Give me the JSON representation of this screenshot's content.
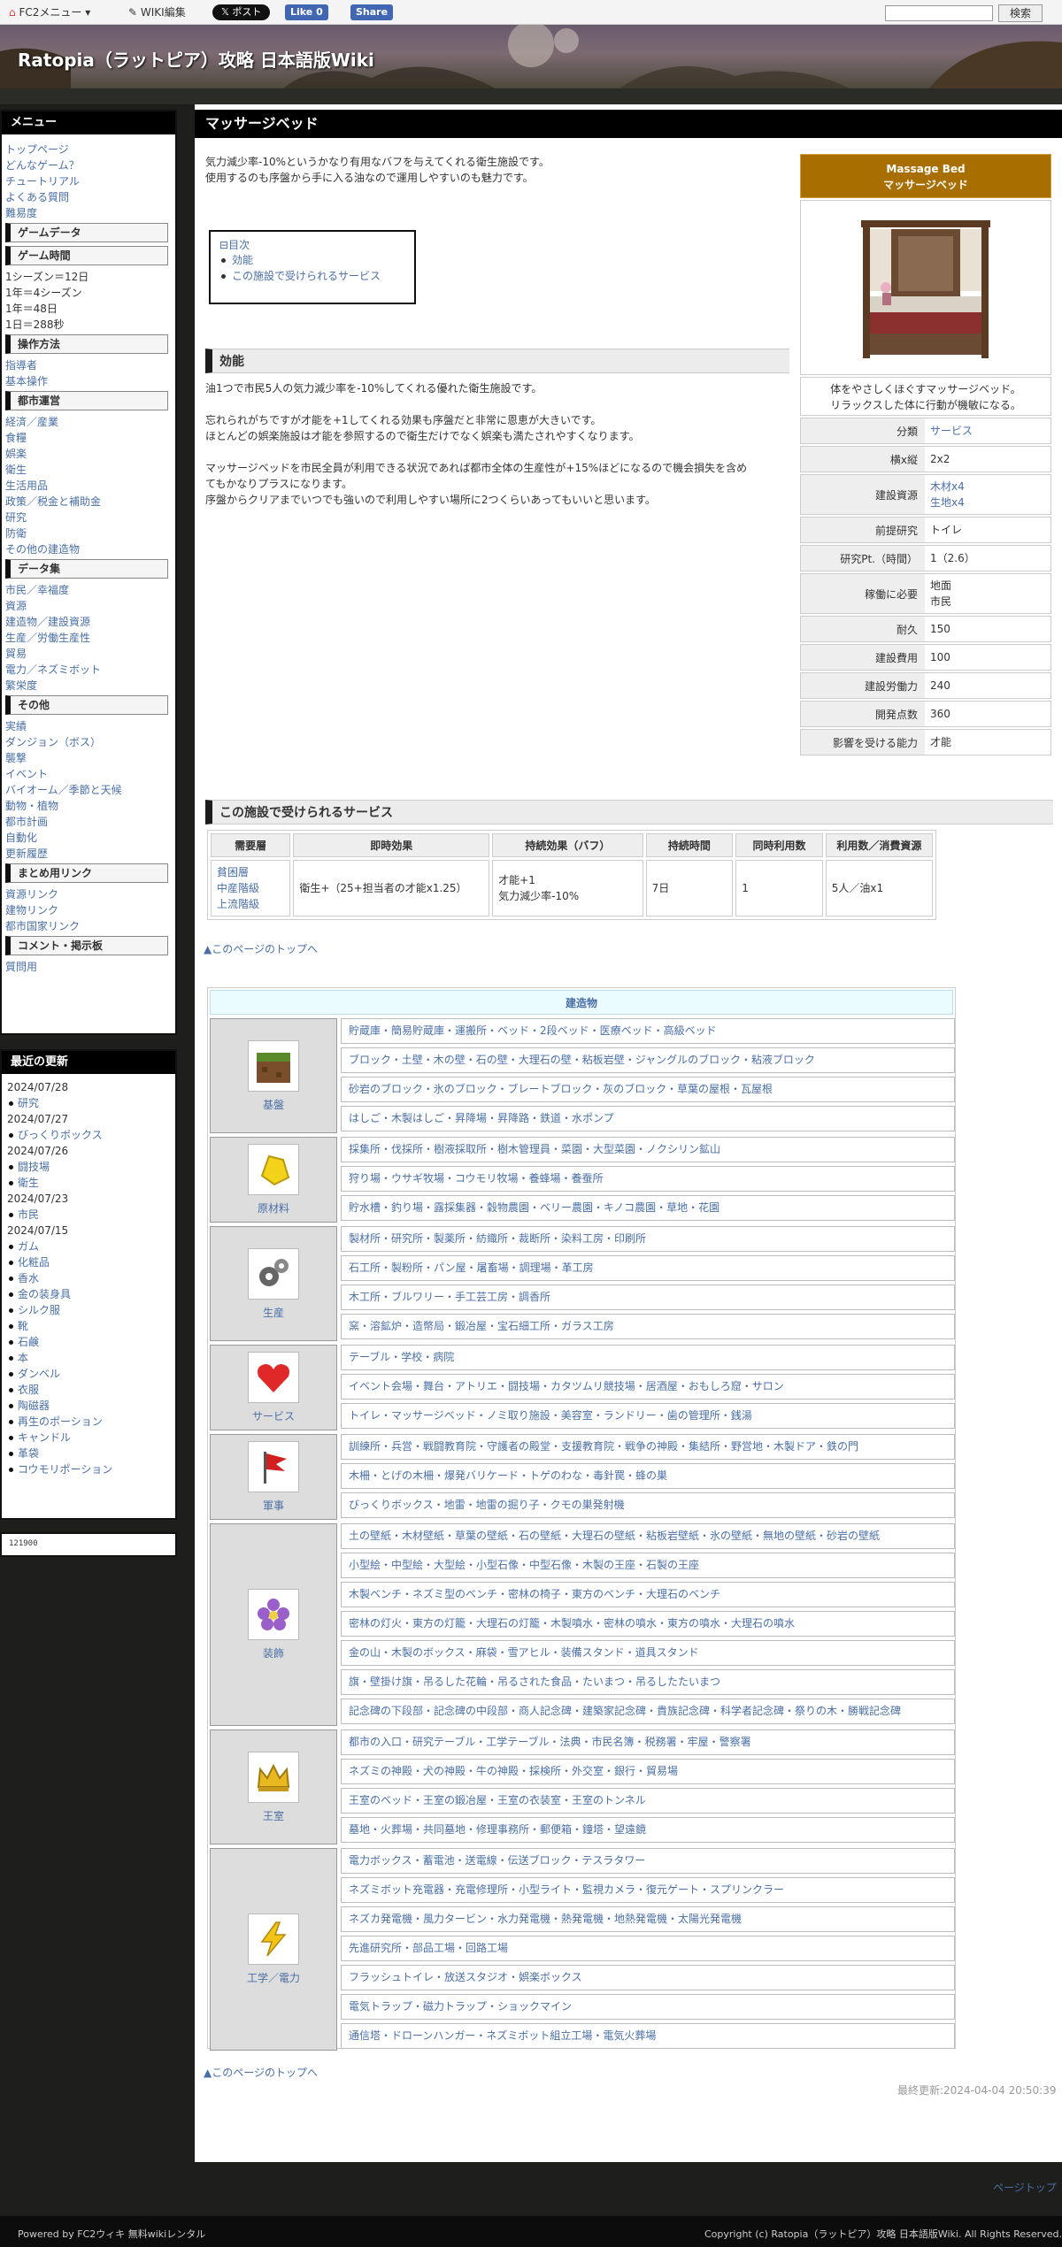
{
  "topbar": {
    "fc2_menu": "FC2メニュー",
    "wiki_edit": "WIKI編集",
    "post": "ポスト",
    "like": "Like 0",
    "share": "Share",
    "search_button": "検索"
  },
  "site_title": "Ratopia（ラットピア）攻略 日本語版Wiki",
  "sidebar": {
    "title": "メニュー",
    "links_top": [
      "トップページ",
      "どんなゲーム？",
      "チュートリアル",
      "よくある質問",
      "難易度"
    ],
    "game_data": "ゲームデータ",
    "game_time": "ゲーム時間",
    "time_lines": [
      "1シーズン＝12日",
      "1年＝4シーズン",
      "1年＝48日",
      "1日＝288秒"
    ],
    "controls": "操作方法",
    "controls_links": [
      "指導者",
      "基本操作"
    ],
    "city": "都市運営",
    "city_links": [
      "経済／産業",
      "食糧",
      "娯楽",
      "衛生",
      "生活用品",
      "政策／税金と補助金",
      "研究",
      "防衛",
      "その他の建造物"
    ],
    "data": "データ集",
    "data_links": [
      "市民／幸福度",
      "資源",
      "建造物／建設資源",
      "生産／労働生産性",
      "貿易",
      "電力／ネズミボット",
      "繁栄度"
    ],
    "other": "その他",
    "other_links": [
      "実績",
      "ダンジョン（ボス）",
      "襲撃",
      "イベント",
      "バイオーム／季節と天候",
      "動物・植物",
      "都市計画",
      "自動化",
      "更新履歴"
    ],
    "links_head": "まとめ用リンク",
    "links_links": [
      "資源リンク",
      "建物リンク",
      "都市国家リンク"
    ],
    "comment": "コメント・掲示板",
    "comment_links": [
      "質問用"
    ]
  },
  "recent": {
    "title": "最近の更新",
    "groups": [
      {
        "date": "2024/07/28",
        "items": [
          "研究"
        ]
      },
      {
        "date": "2024/07/27",
        "items": [
          "びっくりボックス"
        ]
      },
      {
        "date": "2024/07/26",
        "items": [
          "闘技場",
          "衛生"
        ]
      },
      {
        "date": "2024/07/23",
        "items": [
          "市民"
        ]
      },
      {
        "date": "2024/07/15",
        "items": [
          "ガム",
          "化粧品",
          "香水",
          "金の装身具",
          "シルク服",
          "靴",
          "石鹸",
          "本",
          "ダンベル",
          "衣服",
          "陶磁器",
          "再生のポーション",
          "キャンドル",
          "革袋",
          "コウモリポーション"
        ]
      }
    ]
  },
  "counter": "121900",
  "page": {
    "h1": "マッサージベッド",
    "intro1": "気力減少率-10%というかなり有用なバフを与えてくれる衛生施設です。",
    "intro2": "使用するのも序盤から手に入る油なので運用しやすいのも魅力です。",
    "toc_title": "目次",
    "toc_items": [
      "効能",
      "この施設で受けられるサービス"
    ],
    "h2_effect": "効能",
    "eff1": "油1つで市民5人の気力減少率を-10%してくれる優れた衛生施設です。",
    "eff2": "忘れられがちですが才能を+1してくれる効果も序盤だと非常に恩恵が大きいです。",
    "eff3": "ほとんどの娯楽施設は才能を参照するので衛生だけでなく娯楽も満たされやすくなります。",
    "eff4": "マッサージベッドを市民全員が利用できる状況であれば都市全体の生産性が+15%ほどになるので機会損失を含め",
    "eff5": "てもかなりプラスになります。",
    "eff6": "序盤からクリアまでいつでも強いので利用しやすい場所に2つくらいあってもいいと思います。",
    "h2_service": "この施設で受けられるサービス",
    "totop": "▲このページのトップへ",
    "last_update": "最終更新:2024-04-04 20:50:39",
    "ptop": "ページトップ"
  },
  "infobox": {
    "title_en": "Massage Bed",
    "title_ja": "マッサージベッド",
    "desc1": "体をやさしくほぐすマッサージベッド。",
    "desc2": "リラックスした体に行動が機敏になる。",
    "rows": [
      {
        "k": "分類",
        "v": [
          "サービス"
        ]
      },
      {
        "k": "横x縦",
        "v": [
          "2x2"
        ]
      },
      {
        "k": "建設資源",
        "v": [
          "木材x4",
          "生地x4"
        ]
      },
      {
        "k": "前提研究",
        "v": [
          "トイレ"
        ]
      },
      {
        "k": "研究Pt.（時間）",
        "v": [
          "1（2.6）"
        ]
      },
      {
        "k": "稼働に必要",
        "v": [
          "地面",
          "市民"
        ]
      },
      {
        "k": "耐久",
        "v": [
          "150"
        ]
      },
      {
        "k": "建設費用",
        "v": [
          "100"
        ]
      },
      {
        "k": "建設労働力",
        "v": [
          "240"
        ]
      },
      {
        "k": "開発点数",
        "v": [
          "360"
        ]
      },
      {
        "k": "影響を受ける能力",
        "v": [
          "才能"
        ]
      }
    ]
  },
  "service": {
    "headers": [
      "需要層",
      "即時効果",
      "持続効果（バフ）",
      "持続時間",
      "同時利用数",
      "利用数／消費資源"
    ],
    "row": [
      "貧困層\n中産階級\n上流階級",
      "衛生+（25+担当者の才能x1.25）",
      "才能+1\n気力減少率-10%",
      "7日",
      "1",
      "5人／油x1"
    ]
  },
  "buildings": {
    "title": "建造物",
    "categories": [
      {
        "name": "基盤",
        "icon": "soil-block-icon",
        "rows": [
          "貯蔵庫・簡易貯蔵庫・運搬所・ベッド・2段ベッド・医療ベッド・高級ベッド",
          "ブロック・土壁・木の壁・石の壁・大理石の壁・粘板岩壁・ジャングルのブロック・粘液ブロック",
          "砂岩のブロック・氷のブロック・ブレートブロック・灰のブロック・草葉の屋根・瓦屋根",
          "はしご・木製はしご・昇降場・昇降路・鉄道・水ポンプ"
        ]
      },
      {
        "name": "原材料",
        "icon": "gold-ore-icon",
        "rows": [
          "採集所・伐採所・樹液採取所・樹木管理員・菜園・大型菜園・ノクシリン鉱山",
          "狩り場・ウサギ牧場・コウモリ牧場・養蜂場・養蚕所",
          "貯水槽・釣り場・露採集器・穀物農園・ベリー農園・キノコ農園・草地・花園"
        ]
      },
      {
        "name": "生産",
        "icon": "gears-icon",
        "rows": [
          "製材所・研究所・製薬所・紡織所・裁断所・染料工房・印刷所",
          "石工所・製粉所・パン屋・屠畜場・調理場・革工房",
          "木工所・ブルワリー・手工芸工房・調香所",
          "窯・溶鉱炉・造幣局・鍛冶屋・宝石細工所・ガラス工房"
        ]
      },
      {
        "name": "サービス",
        "icon": "heart-icon",
        "rows": [
          "テーブル・学校・病院",
          "イベント会場・舞台・アトリエ・闘技場・カタツムリ競技場・居酒屋・おもしろ窟・サロン",
          "トイレ・マッサージベッド・ノミ取り施設・美容室・ランドリー・歯の管理所・銭湯"
        ]
      },
      {
        "name": "軍事",
        "icon": "red-flag-icon",
        "rows": [
          "訓練所・兵営・戦闘教育院・守護者の殿堂・支援教育院・戦争の神殿・集結所・野営地・木製ドア・鉄の門",
          "木柵・とげの木柵・爆発バリケード・トゲのわな・毒針罠・蜂の巣",
          "びっくりボックス・地雷・地雷の掘り子・クモの巣発射機"
        ]
      },
      {
        "name": "装飾",
        "icon": "flower-icon",
        "rows": [
          "土の壁紙・木材壁紙・草葉の壁紙・石の壁紙・大理石の壁紙・粘板岩壁紙・氷の壁紙・無地の壁紙・砂岩の壁紙",
          "小型絵・中型絵・大型絵・小型石像・中型石像・木製の王座・石製の王座",
          "木製ベンチ・ネズミ型のベンチ・密林の椅子・東方のベンチ・大理石のベンチ",
          "密林の灯火・東方の灯籠・大理石の灯籠・木製噴水・密林の噴水・東方の噴水・大理石の噴水",
          "金の山・木製のボックス・麻袋・雪アヒル・装備スタンド・道具スタンド",
          "旗・壁掛け旗・吊るした花輪・吊るされた食品・たいまつ・吊るしたたいまつ",
          "記念碑の下段部・記念碑の中段部・商人記念碑・建築家記念碑・貴族記念碑・科学者記念碑・祭りの木・勝戦記念碑"
        ]
      },
      {
        "name": "王室",
        "icon": "crown-icon",
        "rows": [
          "都市の入口・研究テーブル・工学テーブル・法典・市民名簿・税務署・牢屋・警察署",
          "ネズミの神殿・犬の神殿・牛の神殿・採検所・外交室・銀行・貿易場",
          "王室のベッド・王室の鍛冶屋・王室の衣装室・王室のトンネル",
          "墓地・火葬場・共同墓地・修理事務所・郵便箱・鐘塔・望遠鏡"
        ]
      },
      {
        "name": "工学／電力",
        "icon": "lightning-icon",
        "rows": [
          "電力ボックス・蓄電池・送電線・伝送ブロック・テスラタワー",
          "ネズミボット充電器・充電修理所・小型ライト・監視カメラ・復元ゲート・スプリンクラー",
          "ネズカ発電機・風力タービン・水力発電機・熱発電機・地熱発電機・太陽光発電機",
          "先進研究所・部品工場・回路工場",
          "フラッシュトイレ・放送スタジオ・娯楽ボックス",
          "電気トラップ・磁力トラップ・ショックマイン",
          "通信塔・ドローンハンガー・ネズミボット組立工場・電気火葬場"
        ]
      }
    ]
  },
  "footer": {
    "left": "Powered by FC2ウィキ 無料wikiレンタル",
    "right": "Copyright (c) Ratopia（ラットピア）攻略 日本語版Wiki. All Rights Reserved."
  }
}
